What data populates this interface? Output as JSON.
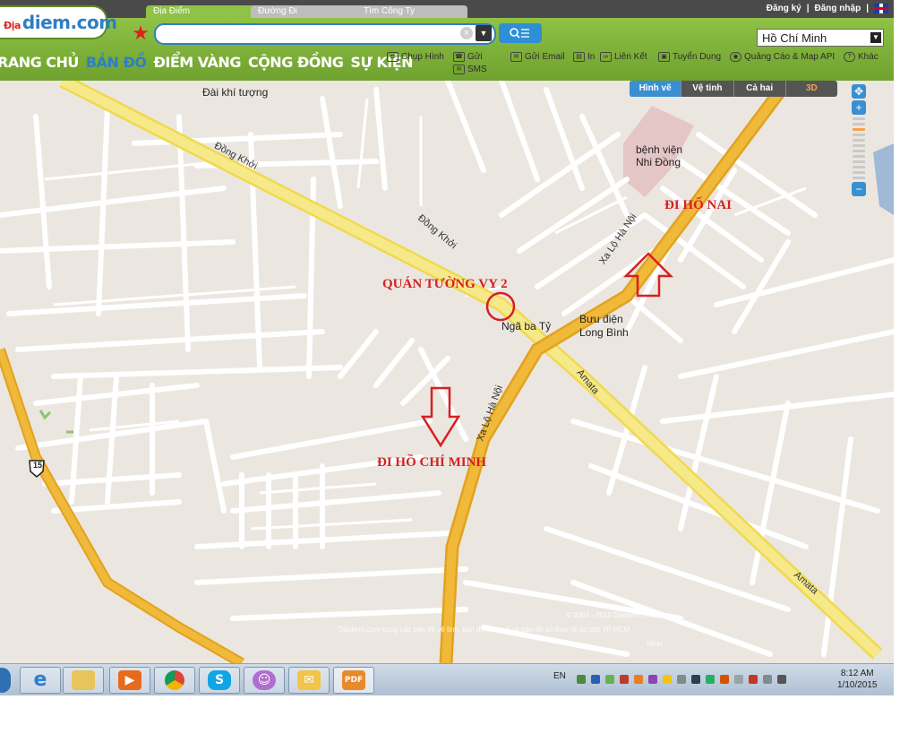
{
  "tabs": [
    {
      "label": "Địa Điểm",
      "active": true
    },
    {
      "label": "Đường Đi",
      "active": false
    },
    {
      "label": "Tìm Công Ty",
      "active": false
    }
  ],
  "top_links": {
    "register": "Đăng ký",
    "sep": "|",
    "login": "Đăng nhập",
    "sep2": "|"
  },
  "logo": {
    "text": "diem.com",
    "prefix": "Địa"
  },
  "search": {
    "placeholder": "",
    "value": ""
  },
  "city": "Hồ Chí Minh",
  "main_nav": [
    "RANG CHỦ",
    "BẢN ĐỒ",
    "ĐIỂM VÀNG",
    "CỘNG ĐỒNG",
    "SỰ KIỆN"
  ],
  "tools": {
    "capture": "Chụp Hình",
    "send": "Gửi",
    "sms": "SMS",
    "email": "Gửi Email",
    "print": "In",
    "link": "Liên Kết",
    "jobs": "Tuyển Dụng",
    "ads": "Quảng Cáo & Map API",
    "other": "Khác"
  },
  "map_type": [
    "Hình vẽ",
    "Vệ tinh",
    "Cả hai",
    "3D"
  ],
  "map": {
    "places": {
      "weather": "Đài khí tượng",
      "hospital": "bệnh viện\nNhi Đồng",
      "junction": "Ngã ba Tỷ",
      "post": "Bưu điện\nLong Bình"
    },
    "roads": {
      "dong_khoi_1": "Đồng Khởi",
      "dong_khoi_2": "Đồng Khởi",
      "xa_lo": "Xa Lộ Hà Nội",
      "xa_lo_2": "Xa Lộ Hà Nội",
      "amata": "Amata",
      "amata_2": "Amata",
      "route": "15"
    },
    "annotations": {
      "shop": "QUÁN TƯỜNG VY 2",
      "to_ho_nai": "ĐI HỐ NAI",
      "to_hcm": "ĐI HỒ CHÍ MINH"
    },
    "copyright_1": "© 2004 - 2015 Diadiem JSC",
    "copyright_2": "Diadiem.com cung cấp bản đồ vệ tinh, bản đồ hình vẽ và bản đồ số thực tế ảo cho TP HCM",
    "copyright_3": "Minh"
  },
  "taskbar": {
    "lang": "EN",
    "time": "8:12 AM",
    "date": "1/10/2015"
  },
  "colors": {
    "header_green": "#7fb23a",
    "accent_blue": "#2f7fc4",
    "annotation_red": "#d62020",
    "highway_yellow": "#f4e27a",
    "expressway_orange": "#efb52e"
  }
}
